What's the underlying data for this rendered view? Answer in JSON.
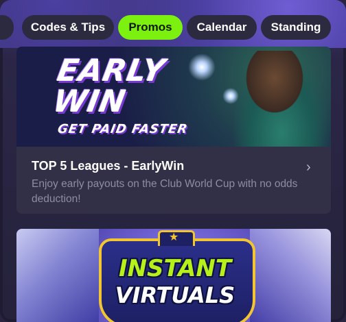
{
  "tabs": [
    {
      "label": "Codes & Tips",
      "active": false
    },
    {
      "label": "Promos",
      "active": true
    },
    {
      "label": "Calendar",
      "active": false
    },
    {
      "label": "Standing",
      "active": false
    }
  ],
  "promo_card": {
    "banner_line1": "EARLY",
    "banner_line2": "WIN",
    "banner_line3": "GET PAID FASTER",
    "title": "TOP 5 Leagues - EarlyWin",
    "description": "Enjoy early payouts on the Club World Cup with no odds deduction!",
    "chevron": "›"
  },
  "promo_card_2": {
    "banner_line1": "INSTANT",
    "banner_line2": "VIRTUALS"
  },
  "colors": {
    "accent": "#7cf10f",
    "card_bg": "#313047",
    "tab_bg": "#2b2a3f"
  }
}
